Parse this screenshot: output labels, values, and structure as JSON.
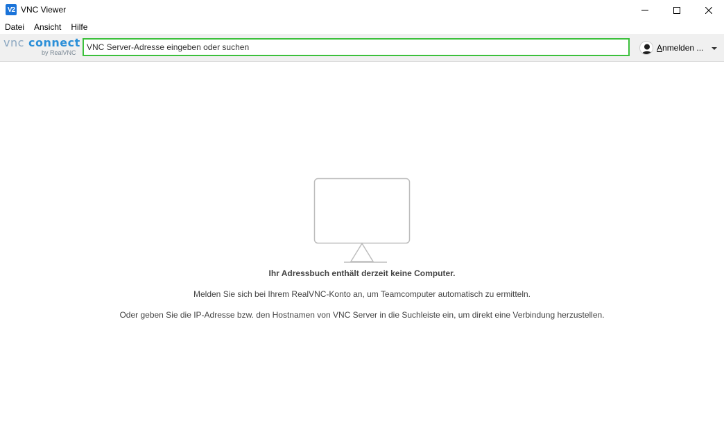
{
  "window": {
    "title": "VNC Viewer",
    "icon_label": "V2"
  },
  "menu": {
    "items": [
      "Datei",
      "Ansicht",
      "Hilfe"
    ]
  },
  "toolbar": {
    "logo_vnc": "vnc",
    "logo_connect": "connect",
    "logo_sub": "by RealVNC",
    "search_placeholder": "VNC Server-Adresse eingeben oder suchen",
    "search_value": "",
    "search_border_color": "#3cc03c",
    "signin_label_underlined": "A",
    "signin_label_rest": "nmelden ..."
  },
  "empty_state": {
    "title": "Ihr Adressbuch enthält derzeit keine Computer.",
    "line1": "Melden Sie sich bei Ihrem RealVNC-Konto an, um Teamcomputer automatisch zu ermitteln.",
    "line2": "Oder geben Sie die IP-Adresse bzw. den Hostnamen von VNC Server in die Suchleiste ein, um direkt eine Verbindung herzustellen."
  },
  "icons": {
    "app": "vnc-app-icon",
    "minimize": "minimize-icon",
    "maximize": "maximize-icon",
    "close": "close-icon",
    "user": "user-avatar-icon",
    "dropdown": "chevron-down-icon",
    "monitor": "monitor-icon"
  }
}
